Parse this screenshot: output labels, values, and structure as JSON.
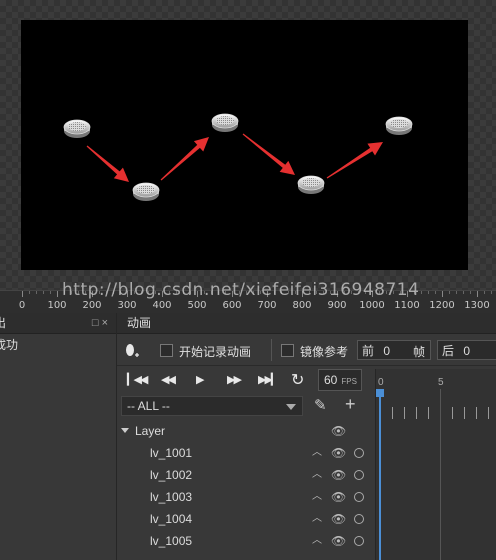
{
  "ruler": {
    "labels": [
      "0",
      "100",
      "200",
      "300",
      "400",
      "500",
      "600",
      "700",
      "800",
      "900",
      "1000",
      "1100",
      "1200",
      "1300"
    ]
  },
  "watermark": "http://blog.csdn.net/xiefeifei316948714",
  "left_panel": {
    "title": "出",
    "icons": "□ ×",
    "row_text": "成功"
  },
  "animation_panel": {
    "title": "动画",
    "record_label": "开始记录动画",
    "mirror_label": "镜像参考",
    "before_label": "前",
    "before_value": "0",
    "frame_label": "帧",
    "after_label": "后",
    "after_value": "0",
    "fps_value": "60",
    "fps_unit": "FPS",
    "filter_value": "-- ALL --",
    "timeline_labels": [
      "0",
      "5"
    ]
  },
  "layers": {
    "root": "Layer",
    "items": [
      "lv_1001",
      "lv_1002",
      "lv_1003",
      "lv_1004",
      "lv_1005"
    ]
  },
  "colors": {
    "accent": "#4b8fd6",
    "arrow": "#e53030"
  }
}
